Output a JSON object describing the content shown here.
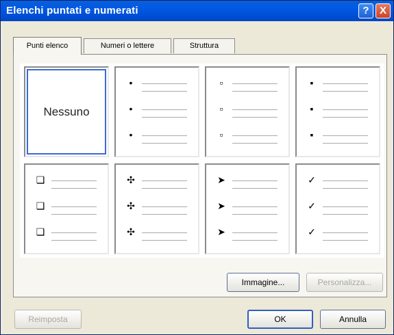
{
  "window": {
    "title": "Elenchi puntati e numerati"
  },
  "titlebar_buttons": {
    "help": "?",
    "close": "X"
  },
  "tabs": [
    {
      "label": "Punti elenco"
    },
    {
      "label": "Numeri o lettere"
    },
    {
      "label": "Struttura"
    }
  ],
  "gallery": {
    "none_label": "Nessuno",
    "styles": [
      {
        "marker": "•",
        "icon": "filled-dot-bullet-icon"
      },
      {
        "marker": "▫",
        "icon": "hollow-square-bullet-icon"
      },
      {
        "marker": "▪",
        "icon": "small-square-bullet-icon"
      },
      {
        "marker": "❑",
        "icon": "shadow-box-bullet-icon"
      },
      {
        "marker": "✣",
        "icon": "four-diamond-bullet-icon"
      },
      {
        "marker": "➤",
        "icon": "arrowhead-bullet-icon"
      },
      {
        "marker": "✓",
        "icon": "checkmark-bullet-icon"
      }
    ]
  },
  "buttons": {
    "image": "Immagine...",
    "customize": "Personalizza...",
    "reset": "Reimposta",
    "ok": "OK",
    "cancel": "Annulla"
  }
}
